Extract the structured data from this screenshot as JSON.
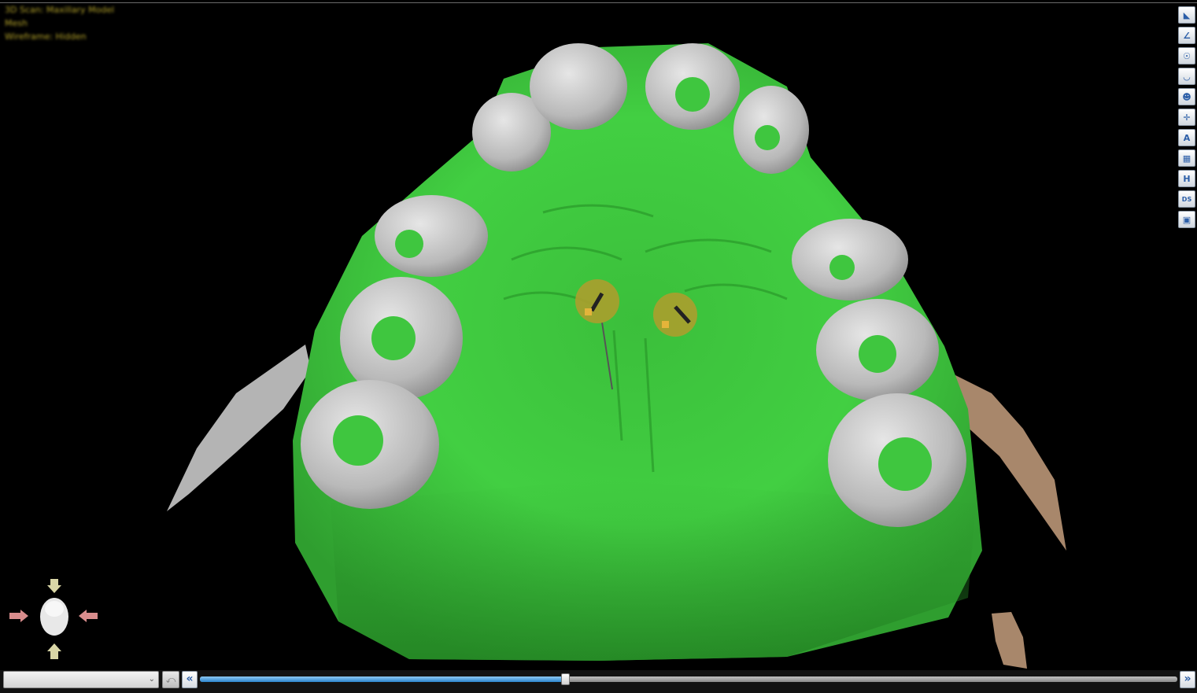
{
  "window": {
    "hud_lines": [
      "3D Scan: Maxillary Model",
      "Mesh",
      "Wireframe: Hidden"
    ]
  },
  "toolbar": {
    "tools": [
      {
        "name": "ruler-icon",
        "glyph": "◣"
      },
      {
        "name": "angle-icon",
        "glyph": "∠"
      },
      {
        "name": "skull-icon",
        "glyph": "☉"
      },
      {
        "name": "arch-icon",
        "glyph": "◡"
      },
      {
        "name": "face-icon",
        "glyph": "☻"
      },
      {
        "name": "axis-icon",
        "glyph": "✛"
      },
      {
        "name": "text-icon",
        "glyph": "A"
      },
      {
        "name": "grid-icon",
        "glyph": "▦"
      },
      {
        "name": "dimension-icon",
        "glyph": "H"
      },
      {
        "name": "ds-icon",
        "glyph": "DS"
      },
      {
        "name": "screenshot-icon",
        "glyph": "▣"
      }
    ]
  },
  "markers": [
    {
      "name": "implant-marker-left"
    },
    {
      "name": "implant-marker-right"
    }
  ],
  "bottom": {
    "view_select": {
      "value": ""
    },
    "undo_glyph": "⤺",
    "prev_glyph": "«",
    "next_glyph": "»",
    "slider": {
      "value": 0.374
    }
  },
  "colors": {
    "model_green": "#3fcc3f",
    "tooth_gray": "#c8c8c8",
    "bone_tan": "#a8876b",
    "marker": "#a89f2e",
    "hud_text": "#b3a22a"
  }
}
